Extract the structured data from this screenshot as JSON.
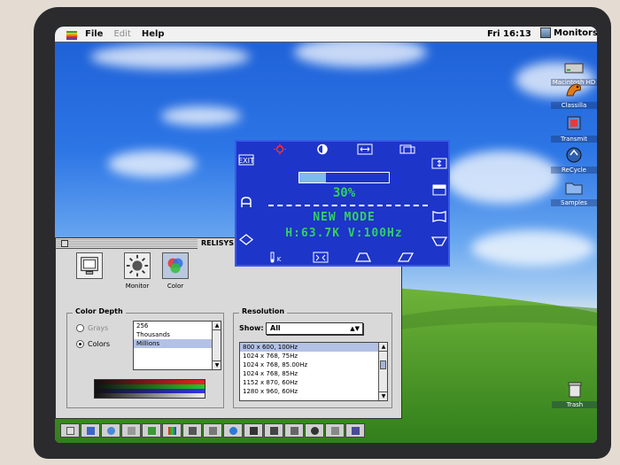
{
  "menubar": {
    "items": [
      "File",
      "Edit",
      "Help"
    ],
    "clock": "Fri 16:13",
    "app_name": "Monitors"
  },
  "desktop_icons": [
    {
      "label": "Macintosh HD",
      "icon": "hard-disk-icon"
    },
    {
      "label": "Classilla",
      "icon": "classilla-icon"
    },
    {
      "label": "Transmit",
      "icon": "transmit-icon"
    },
    {
      "label": "ReCycle",
      "icon": "recycle-icon"
    },
    {
      "label": "Samples",
      "icon": "folder-icon"
    },
    {
      "label": "Trash",
      "icon": "trash-icon"
    }
  ],
  "osd": {
    "progress_percent": 30,
    "progress_label": "30%",
    "mode_text": "NEW MODE",
    "freq_text": "H:63.7K V:100Hz",
    "colors": {
      "background": "#1d35c9",
      "text": "#33d060",
      "accent": "#ff3030"
    }
  },
  "window": {
    "title": "RELISYS",
    "toolbar": [
      {
        "label": "",
        "icon": "monitor-icon"
      },
      {
        "label": "Monitor",
        "icon": "brightness-icon"
      },
      {
        "label": "Color",
        "icon": "color-icon"
      }
    ],
    "color_depth": {
      "title": "Color Depth",
      "grays_label": "Grays",
      "colors_label": "Colors",
      "selected": "Colors",
      "options": [
        "256",
        "Thousands",
        "Millions"
      ],
      "selected_option": "Millions"
    },
    "resolution": {
      "title": "Resolution",
      "show_label": "Show:",
      "show_value": "All",
      "items": [
        "800 x 600, 100Hz",
        "1024 x 768, 75Hz",
        "1024 x 768, 85.00Hz",
        "1024 x 768, 85Hz",
        "1152 x 870, 60Hz",
        "1280 x 960, 60Hz"
      ],
      "selected_item": "800 x 600, 100Hz"
    }
  }
}
